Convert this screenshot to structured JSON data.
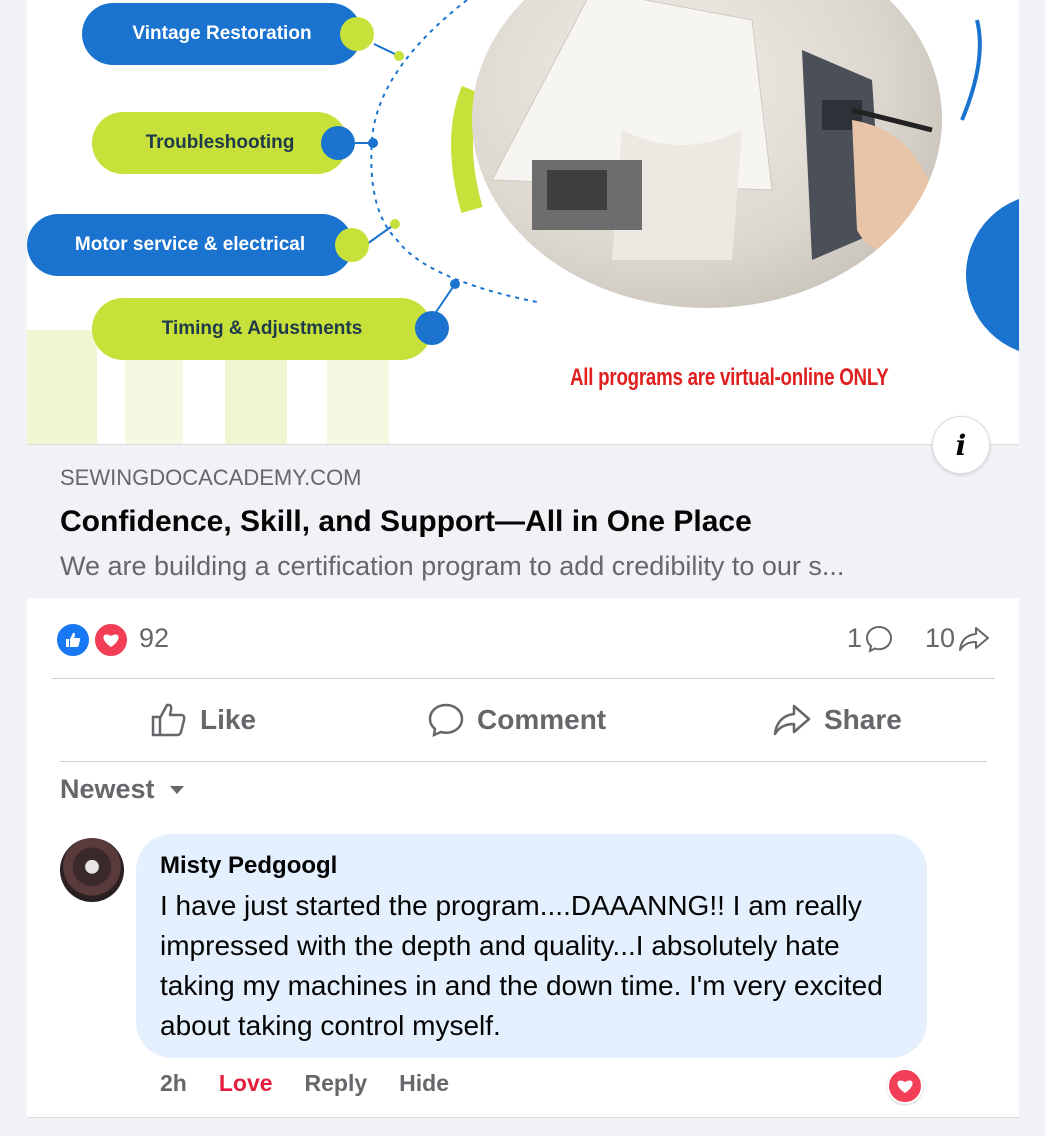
{
  "ad_image": {
    "services": [
      {
        "label": "Vintage Restoration"
      },
      {
        "label": "Troubleshooting"
      },
      {
        "label": "Motor service & electrical"
      },
      {
        "label": "Timing & Adjustments"
      }
    ],
    "caption": "All programs are virtual-online ONLY",
    "info_label": "i",
    "colors": {
      "blue": "#1a73cf",
      "green": "#c7e03a",
      "caption_red": "#e02020"
    }
  },
  "link_preview": {
    "domain": "SEWINGDOCACADEMY.COM",
    "title": "Confidence, Skill, and Support—All in One Place",
    "description": "We are building a certification program to add credibility to our s..."
  },
  "reactions": {
    "icons": [
      "like-icon",
      "love-icon"
    ],
    "count": "92",
    "comments_count": "1",
    "shares_count": "10"
  },
  "actions": {
    "like": "Like",
    "comment": "Comment",
    "share": "Share"
  },
  "comments": {
    "sort_label": "Newest",
    "items": [
      {
        "author": "Misty Pedgoogl",
        "text": "I have just started the program....DAAANNG!! I am really impressed with the depth and quality...I absolutely hate taking my machines in and the down time. I'm very excited about taking control myself.",
        "time": "2h",
        "love_label": "Love",
        "reply_label": "Reply",
        "hide_label": "Hide",
        "reaction_icon": "love-icon"
      }
    ]
  },
  "colors": {
    "secondary_text": "#65676b",
    "primary_text": "#050505",
    "like_blue": "#1877f2",
    "love_red": "#f33e58",
    "comment_bubble": "#e4f0fd"
  }
}
